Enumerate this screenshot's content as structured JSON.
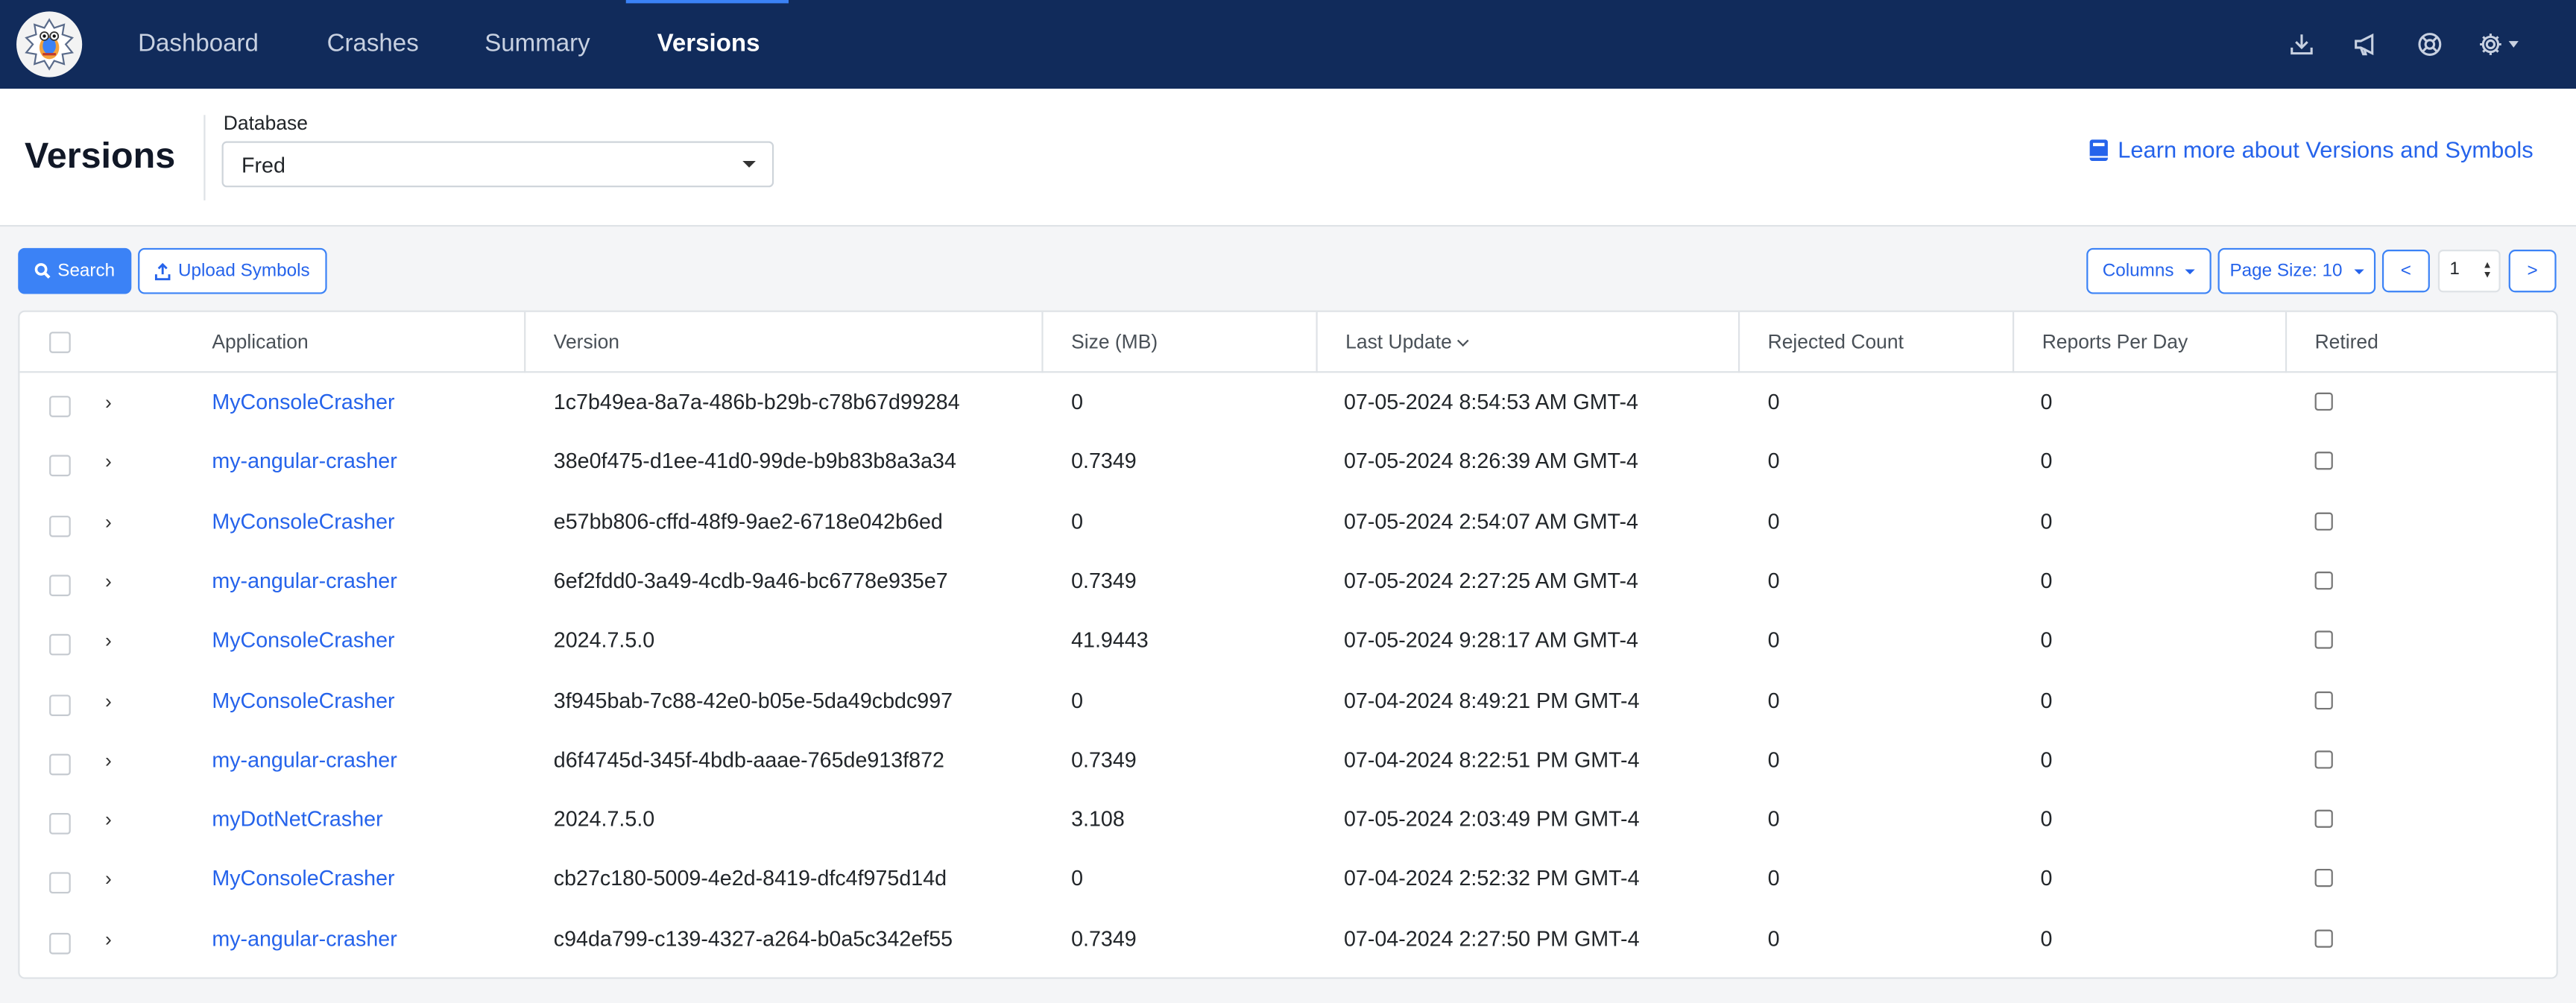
{
  "nav": {
    "items": [
      {
        "label": "Dashboard",
        "active": false
      },
      {
        "label": "Crashes",
        "active": false
      },
      {
        "label": "Summary",
        "active": false
      },
      {
        "label": "Versions",
        "active": true
      }
    ],
    "icons": [
      "download-icon",
      "megaphone-icon",
      "support-icon",
      "gear-icon"
    ]
  },
  "header": {
    "title": "Versions",
    "database_label": "Database",
    "database_value": "Fred",
    "learn_more": "Learn more about Versions and Symbols"
  },
  "toolbar": {
    "search_label": "Search",
    "upload_label": "Upload Symbols",
    "columns_label": "Columns",
    "page_size_label": "Page Size: 10",
    "prev_label": "<",
    "next_label": ">",
    "page_number": "1"
  },
  "table": {
    "headers": {
      "application": "Application",
      "version": "Version",
      "size": "Size (MB)",
      "last_update": "Last Update",
      "rejected_count": "Rejected Count",
      "reports_per_day": "Reports Per Day",
      "retired": "Retired"
    },
    "rows": [
      {
        "application": "MyConsoleCrasher",
        "version": "1c7b49ea-8a7a-486b-b29b-c78b67d99284",
        "size": "0",
        "last_update": "07-05-2024 8:54:53 AM GMT-4",
        "rejected_count": "0",
        "reports_per_day": "0"
      },
      {
        "application": "my-angular-crasher",
        "version": "38e0f475-d1ee-41d0-99de-b9b83b8a3a34",
        "size": "0.7349",
        "last_update": "07-05-2024 8:26:39 AM GMT-4",
        "rejected_count": "0",
        "reports_per_day": "0"
      },
      {
        "application": "MyConsoleCrasher",
        "version": "e57bb806-cffd-48f9-9ae2-6718e042b6ed",
        "size": "0",
        "last_update": "07-05-2024 2:54:07 AM GMT-4",
        "rejected_count": "0",
        "reports_per_day": "0"
      },
      {
        "application": "my-angular-crasher",
        "version": "6ef2fdd0-3a49-4cdb-9a46-bc6778e935e7",
        "size": "0.7349",
        "last_update": "07-05-2024 2:27:25 AM GMT-4",
        "rejected_count": "0",
        "reports_per_day": "0"
      },
      {
        "application": "MyConsoleCrasher",
        "version": "2024.7.5.0",
        "size": "41.9443",
        "last_update": "07-05-2024 9:28:17 AM GMT-4",
        "rejected_count": "0",
        "reports_per_day": "0"
      },
      {
        "application": "MyConsoleCrasher",
        "version": "3f945bab-7c88-42e0-b05e-5da49cbdc997",
        "size": "0",
        "last_update": "07-04-2024 8:49:21 PM GMT-4",
        "rejected_count": "0",
        "reports_per_day": "0"
      },
      {
        "application": "my-angular-crasher",
        "version": "d6f4745d-345f-4bdb-aaae-765de913f872",
        "size": "0.7349",
        "last_update": "07-04-2024 8:22:51 PM GMT-4",
        "rejected_count": "0",
        "reports_per_day": "0"
      },
      {
        "application": "myDotNetCrasher",
        "version": "2024.7.5.0",
        "size": "3.108",
        "last_update": "07-05-2024 2:03:49 PM GMT-4",
        "rejected_count": "0",
        "reports_per_day": "0"
      },
      {
        "application": "MyConsoleCrasher",
        "version": "cb27c180-5009-4e2d-8419-dfc4f975d14d",
        "size": "0",
        "last_update": "07-04-2024 2:52:32 PM GMT-4",
        "rejected_count": "0",
        "reports_per_day": "0"
      },
      {
        "application": "my-angular-crasher",
        "version": "c94da799-c139-4327-a264-b0a5c342ef55",
        "size": "0.7349",
        "last_update": "07-04-2024 2:27:50 PM GMT-4",
        "rejected_count": "0",
        "reports_per_day": "0"
      }
    ]
  }
}
